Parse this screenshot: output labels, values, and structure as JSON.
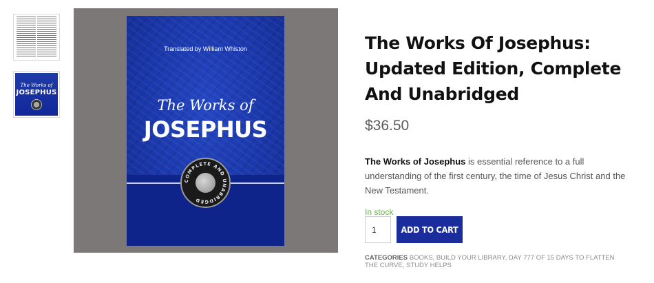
{
  "gallery": {
    "thumbnails": [
      {
        "name": "text-page-preview"
      },
      {
        "name": "cover-preview",
        "title_line1": "The Works of",
        "title_line2": "JOSEPHUS"
      }
    ],
    "cover": {
      "translated_by": "Translated by William Whiston",
      "title_line1": "The Works of",
      "title_line2": "JOSEPHUS",
      "seal_text": "COMPLETE AND UNABRIDGED"
    },
    "colors": {
      "cover_blue": "#1b37aa",
      "background": "#7c7878"
    }
  },
  "product": {
    "title": "The Works Of Josephus: Updated Edition, Complete And Unabridged",
    "price": "$36.50",
    "description_bold": "The Works of Josephus",
    "description_rest": " is essential reference to a full understanding of the first century, the time of Jesus Christ and the New Testament.",
    "stock": "In stock",
    "quantity": "1",
    "add_to_cart": "ADD TO CART",
    "categories_label": "CATEGORIES",
    "categories": [
      "BOOKS",
      "BUILD YOUR LIBRARY",
      "DAY 777 OF 15 DAYS TO FLATTEN THE CURVE",
      "STUDY HELPS"
    ]
  },
  "colors": {
    "button": "#1b2c9d",
    "stock_green": "#6ab04c"
  }
}
